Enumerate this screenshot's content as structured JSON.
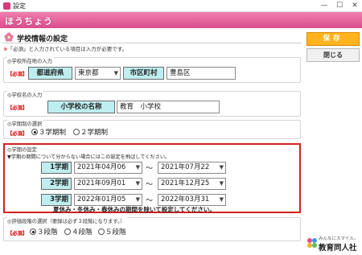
{
  "window": {
    "title": "設定",
    "minimize": "—",
    "maximize": "☐",
    "close": "✕"
  },
  "brand": {
    "logo_text": "ほうちょう"
  },
  "page": {
    "heading": "学校情報の設定",
    "note_mark": "※",
    "note_text": "「必須」と入力されている項目は入力が必要です。"
  },
  "required_label": "【必須】",
  "address": {
    "section_title": "◎学校所在地の入力",
    "pref_label": "都道府県",
    "pref_value": "東京都",
    "city_label": "市区町村",
    "city_value": "豊島区"
  },
  "school_name": {
    "section_title": "◎学校名の入力",
    "label": "小学校の名称",
    "value": "教育　小学校"
  },
  "term_system": {
    "section_title": "◎学期制の選択",
    "options": [
      "３学期制",
      "２学期制"
    ],
    "selected": 0
  },
  "term_settings": {
    "section_title": "◎学期の設定",
    "instruction": "▼学期の期間について分からない場合にはこの設定を飛ばしてください。",
    "terms": [
      {
        "label": "1学期",
        "start": "2021年04月06",
        "end": "2021年07月22"
      },
      {
        "label": "2学期",
        "start": "2021年09月01",
        "end": "2021年12月25"
      },
      {
        "label": "3学期",
        "start": "2022年01月05",
        "end": "2022年03月31"
      }
    ],
    "tilde": "～",
    "footnote": "夏休み・冬休み・春休みの期間を除いて設定してください。"
  },
  "grading": {
    "section_title": "◎評価段階の選択（要録は必ず３段階になります。）",
    "options": [
      "３段階",
      "４段階",
      "５段階"
    ],
    "selected": 0
  },
  "sidebar": {
    "save_label": "保存",
    "close_label": "閉じる",
    "footer_sub": "みんなにスマイル。",
    "footer_main": "教育同人社"
  },
  "colors": {
    "brand_pink": "#e05f9c",
    "save_orange": "#ffb31f",
    "field_cyan": "#bfeef0",
    "required_red": "#d00000",
    "term_border": "#d42020"
  }
}
